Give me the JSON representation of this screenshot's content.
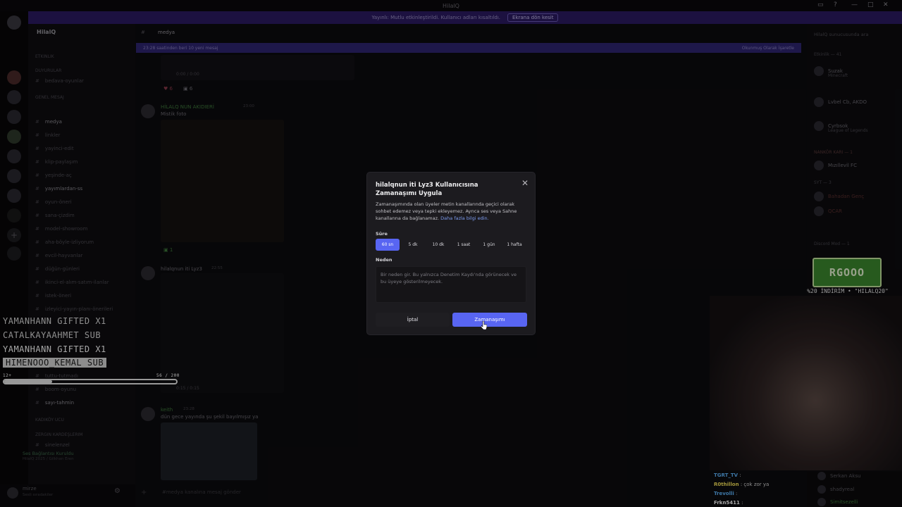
{
  "window": {
    "title": "HilalQ"
  },
  "notice": {
    "text": "Yayınlı: Mutlu etkinleştirildi. Kullanıcı adları kısaltıldı.",
    "button": "Ekrana dön kesit"
  },
  "sidebar": {
    "server_name": "HilalQ",
    "categories": [
      {
        "label": "Etkinlik"
      },
      {
        "label": "DUYURULAR"
      },
      {
        "label": "GENEL MESAJ"
      }
    ],
    "channels": [
      {
        "label": "bedava-oyunlar"
      },
      {
        "label": "medya"
      },
      {
        "label": "linkler"
      },
      {
        "label": "yayinci-edit"
      },
      {
        "label": "klip-paylaşım"
      },
      {
        "label": "yeşinde-aç"
      },
      {
        "label": "yayımlardan-ss"
      },
      {
        "label": "oyun-öneri"
      },
      {
        "label": "sana-çizdim"
      },
      {
        "label": "model-showroom"
      },
      {
        "label": "aha-böyle-izliyorum"
      },
      {
        "label": "evcil-hayvanlar"
      },
      {
        "label": "düğün-günleri"
      },
      {
        "label": "ikinci-el-alım-satım-ilanlar"
      },
      {
        "label": "istek-öneri"
      },
      {
        "label": "izleyici-yayın-planı-önerileri"
      },
      {
        "label": "tuttu-tutmadı"
      },
      {
        "label": "boom-oyunu"
      },
      {
        "label": "sayı-tahmin"
      }
    ],
    "footer_cats": [
      {
        "label": "Kadıköy Ucu"
      },
      {
        "label": "Zergin Kardeşlerim"
      },
      {
        "label": "sinelenzel"
      }
    ],
    "voice_status": "Ses Bağlantısı Kuruldu",
    "voice_sub": "HilalQ 2025 / Gilkhan Eren",
    "user": "mirze",
    "user_status": "Sesli sıradakiler"
  },
  "main": {
    "channel": "medya",
    "unread_text": "23:28 saatinden beri 10 yeni mesaj",
    "unread_action": "Okunmuş Olarak İşaretle",
    "messages": [
      {
        "author": "HİLALQ NUN AKIDIERİ",
        "time": "23:00",
        "text": "Mistik foto"
      },
      {
        "author": "hilalqnun iti Lyz3",
        "time": "22:55"
      },
      {
        "author": "keith",
        "time": "23:28",
        "text": "dün gece yayında şu şekil bayılmışız ya"
      }
    ],
    "video_time_1": "0:00 / 0:00",
    "video_time_2": "0:15 / 0:15",
    "reaction_1": "6",
    "reaction_2": "6",
    "reaction_3": "1",
    "input_placeholder": "#medya kanalına mesaj gönder"
  },
  "members": {
    "search": "HilalQ sunucusunda ara",
    "groups": [
      {
        "label": "Etkinlik — 41"
      },
      {
        "label": "NANKÖR KARI — 1"
      },
      {
        "label": "SYT — 3"
      },
      {
        "label": "Discord Mod — 1"
      }
    ],
    "list": [
      {
        "name": "Suzak",
        "sub": "Minecraft"
      },
      {
        "name": "Lvbel Cb, AKDO",
        "sub": ""
      },
      {
        "name": "Cyrbsok",
        "sub": "League of Legends"
      },
      {
        "name": "Mızıllevil FC",
        "sub": ""
      },
      {
        "name": "Bahadan Genç",
        "sub": "OMER"
      },
      {
        "name": "QCAR",
        "sub": ""
      }
    ]
  },
  "overlay": {
    "subs": [
      {
        "text": "YAMANHANN  GIFTED X1",
        "style": "plain"
      },
      {
        "text": "CATALKAYAAHMET  SUB",
        "style": "plain"
      },
      {
        "text": "YAMANHANN  GIFTED X1",
        "style": "plain"
      },
      {
        "text": "HIMENOOO_KEMAL  SUB",
        "style": "highlight"
      }
    ],
    "goal_label": "12+",
    "goal_count": "56  / 200",
    "goal_fraction": 0.28,
    "promo_logo": "RGOOO",
    "promo_code": "%20 İNDİRİM • \"HILALQ20\"",
    "chat": [
      {
        "user": "TGRT_TV",
        "color": "#5fb7ff",
        "msg": ":"
      },
      {
        "user": "R0thillon",
        "color": "#f7e45a",
        "msg": ": çok zor ya"
      },
      {
        "user": "Trevolli",
        "color": "#5fb7ff",
        "msg": ":"
      },
      {
        "user": "Frkn5411",
        "color": "#ffffff",
        "msg": ":"
      }
    ],
    "right_members": [
      {
        "name": "Serkan Aksu"
      },
      {
        "name": "shadyreal"
      },
      {
        "name": "Simitsezelli"
      }
    ]
  },
  "modal": {
    "title": "hilalqnun iti Lyz3 Kullanıcısına Zamanaşımı Uygula",
    "description": "Zamanaşımında olan üyeler metin kanallarında geçici olarak sohbet edemez veya tepki ekleyemez. Ayrıca ses veya Sahne kanallarına da bağlanamaz.",
    "link": "Daha fazla bilgi edin.",
    "duration_label": "Süre",
    "durations": [
      "60 sn",
      "5 dk",
      "10 dk",
      "1 saat",
      "1 gün",
      "1 hafta"
    ],
    "selected_duration": "60 sn",
    "reason_label": "Neden",
    "reason_placeholder": "Bir neden gir. Bu yalnızca Denetim Kaydı'nda görünecek ve bu üyeye gösterilmeyecek.",
    "cancel": "İptal",
    "confirm": "Zamanaşımı"
  },
  "colors": {
    "accent": "#5865f2",
    "notice": "#2b1b63",
    "promo": "#3d8a2e"
  }
}
